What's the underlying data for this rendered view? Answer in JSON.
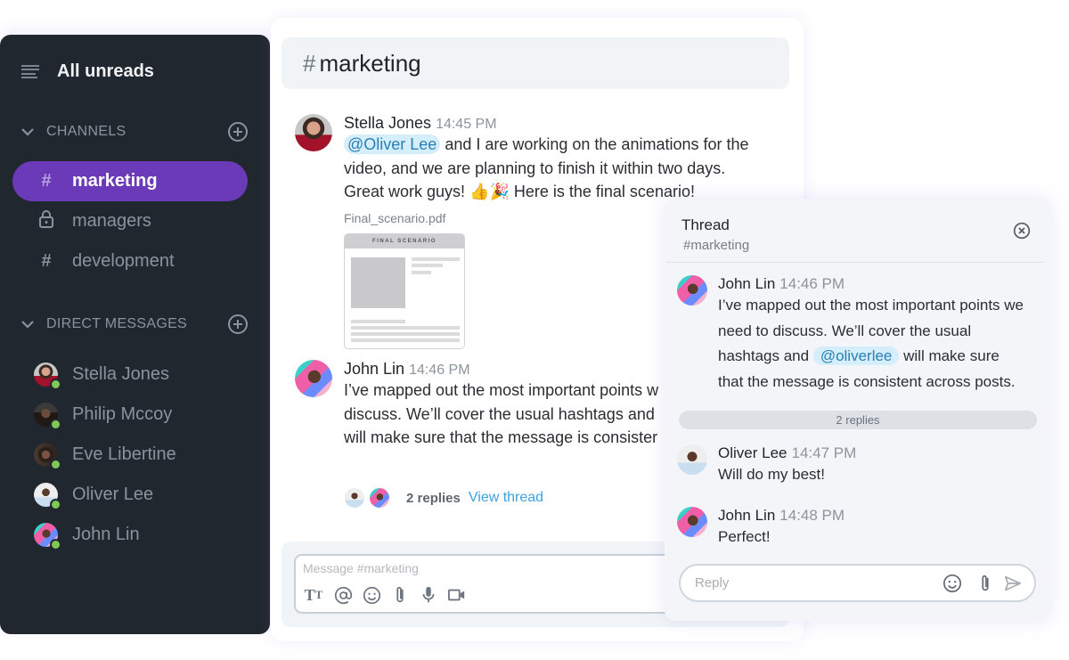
{
  "sidebar": {
    "title": "All unreads",
    "channels_label": "CHANNELS",
    "channels": [
      {
        "name": "marketing",
        "icon": "hash-icon",
        "active": true
      },
      {
        "name": "managers",
        "icon": "lock-icon",
        "active": false
      },
      {
        "name": "development",
        "icon": "hash-icon",
        "active": false
      }
    ],
    "dm_label": "DIRECT MESSAGES",
    "direct_messages": [
      {
        "name": "Stella Jones",
        "status": "online"
      },
      {
        "name": "Philip Mccoy",
        "status": "online"
      },
      {
        "name": "Eve Libertine",
        "status": "online"
      },
      {
        "name": "Oliver Lee",
        "status": "online"
      },
      {
        "name": "John Lin",
        "status": "online"
      }
    ]
  },
  "channel": {
    "hash": "#",
    "name": "marketing",
    "messages": [
      {
        "author": "Stella Jones",
        "time": "14:45 PM",
        "mention": "@Oliver Lee",
        "line1": " and I are working on the animations for the",
        "line2": "video, and we are planning to finish it within two days.",
        "line3": "Great work guys! 👍🎉  Here is the final scenario!",
        "attachment": {
          "filename": "Final_scenario.pdf",
          "preview_title": "FINAL SCENARIO"
        }
      },
      {
        "author": "John Lin",
        "time": "14:46 PM",
        "line1": "I’ve mapped out the most important points w",
        "line2": "discuss. We’ll cover the usual hashtags and",
        "line3": "will make sure that the message is consister",
        "replies": "2 replies",
        "view_thread": "View thread"
      }
    ],
    "composer_placeholder": "Message #marketing",
    "composer_tools": [
      "text-format-icon",
      "mention-icon",
      "emoji-icon",
      "attachment-icon",
      "microphone-icon",
      "video-icon"
    ]
  },
  "thread": {
    "title": "Thread",
    "channel": "#marketing",
    "root": {
      "author": "John Lin",
      "time": "14:46 PM",
      "line1": "I’ve mapped out the most important points we",
      "line2": "need to discuss. We’ll cover the usual",
      "line3_before": "hashtags and ",
      "mention": "@oliverlee",
      "line3_after": " will make sure",
      "line4": "that the message is consistent across posts."
    },
    "replies_label": "2 replies",
    "replies": [
      {
        "author": "Oliver Lee",
        "time": "14:47 PM",
        "text": "Will do my best!"
      },
      {
        "author": "John Lin",
        "time": "14:48 PM",
        "text": "Perfect!"
      }
    ],
    "reply_placeholder": "Reply"
  },
  "colors": {
    "sidebar_bg": "#21272e",
    "accent": "#6a3ab8",
    "presence": "#7dc954",
    "mention_bg": "#d4eefb",
    "link": "#3da0e0"
  }
}
